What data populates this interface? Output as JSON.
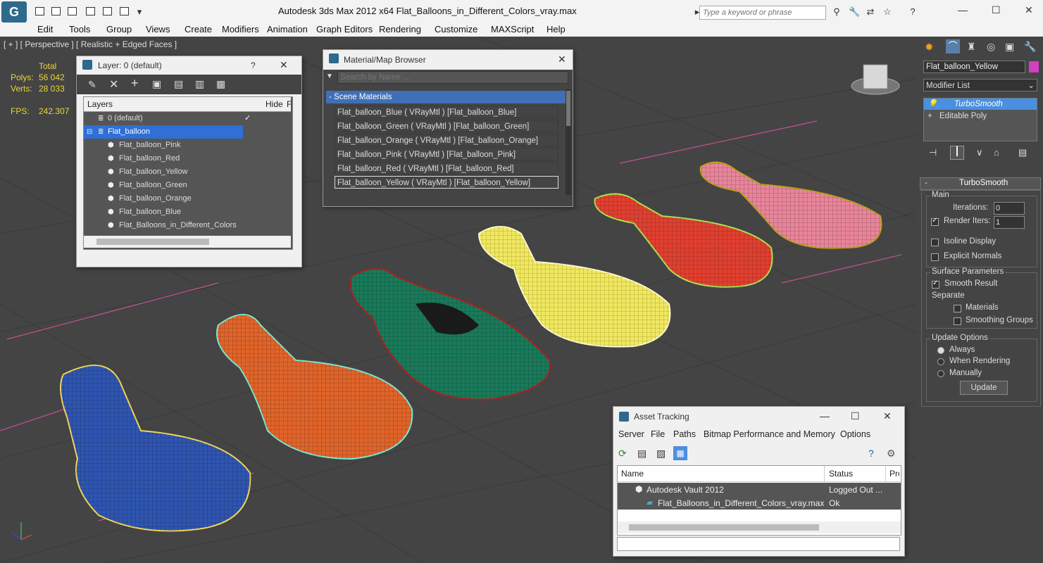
{
  "titlebar": {
    "logo_text": "G",
    "title": "Autodesk 3ds Max  2012 x64      Flat_Balloons_in_Different_Colors_vray.max",
    "search_placeholder": "Type a keyword or phrase",
    "quick_access_icons": [
      "new-icon",
      "open-icon",
      "save-icon",
      "undo-icon",
      "redo-icon",
      "settings-icon"
    ],
    "tool_icons": [
      "binoculars-icon",
      "tools-icon",
      "exchange-icon",
      "star-icon",
      "help-icon"
    ],
    "window_controls": [
      "—",
      "☐",
      "✕"
    ]
  },
  "menubar": {
    "items": [
      "Edit",
      "Tools",
      "Group",
      "Views",
      "Create",
      "Modifiers",
      "Animation",
      "Graph Editors",
      "Rendering",
      "Customize",
      "MAXScript",
      "Help"
    ]
  },
  "viewport": {
    "label": "[ + ] [ Perspective ] [ Realistic + Edged Faces ]",
    "stats": {
      "total_label": "Total",
      "polys_label": "Polys:",
      "polys_value": "56 042",
      "verts_label": "Verts:",
      "verts_value": "28 033",
      "fps_label": "FPS:",
      "fps_value": "242.307"
    },
    "balloon_colors": {
      "blue": "#2f55b0",
      "orange": "#e0642a",
      "green": "#1a7a5a",
      "yellow": "#f0e860",
      "red": "#e04030",
      "pink": "#e8859a"
    }
  },
  "layer_window": {
    "title": "Layer: 0 (default)",
    "help": "?",
    "close": "✕",
    "columns": {
      "layers": "Layers",
      "hide": "Hide",
      "freeze": "F"
    },
    "rows": [
      {
        "name": "0 (default)",
        "indent": 1
      },
      {
        "name": "Flat_balloon",
        "indent": 0
      },
      {
        "name": "Flat_balloon_Pink",
        "indent": 2
      },
      {
        "name": "Flat_balloon_Red",
        "indent": 2
      },
      {
        "name": "Flat_balloon_Yellow",
        "indent": 2
      },
      {
        "name": "Flat_balloon_Green",
        "indent": 2
      },
      {
        "name": "Flat_balloon_Orange",
        "indent": 2
      },
      {
        "name": "Flat_balloon_Blue",
        "indent": 2
      },
      {
        "name": "Flat_Balloons_in_Different_Colors",
        "indent": 2
      }
    ],
    "toolbar_icons": [
      "new-layer-icon",
      "delete-layer-icon",
      "add-selection-icon",
      "select-highlight-icon",
      "highlight-selected-icon",
      "hide-all-icon",
      "freeze-all-icon"
    ]
  },
  "material_browser": {
    "title": "Material/Map Browser",
    "close": "✕",
    "search_placeholder": "Search by Name ...",
    "group_label": "- Scene Materials",
    "materials": [
      "Flat_balloon_Blue  ( VRayMtl )  [Flat_balloon_Blue]",
      "Flat_balloon_Green  ( VRayMtl )  [Flat_balloon_Green]",
      "Flat_balloon_Orange  ( VRayMtl )  [Flat_balloon_Orange]",
      "Flat_balloon_Pink  ( VRayMtl )  [Flat_balloon_Pink]",
      "Flat_balloon_Red  ( VRayMtl )  [Flat_balloon_Red]",
      "Flat_balloon_Yellow  ( VRayMtl )  [Flat_balloon_Yellow]"
    ]
  },
  "command_panel": {
    "object_name": "Flat_balloon_Yellow",
    "object_color": "#d040c0",
    "modifier_list": "Modifier List",
    "stack": [
      "TurboSmooth",
      "Editable Poly"
    ],
    "rollout_title": "TurboSmooth",
    "main_label": "Main",
    "iterations_label": "Iterations:",
    "iterations_value": "0",
    "render_iters_label": "Render Iters:",
    "render_iters_value": "1",
    "isoline_label": "Isoline Display",
    "explicit_normals_label": "Explicit Normals",
    "surface_params_label": "Surface Parameters",
    "smooth_result_label": "Smooth Result",
    "separate_label": "Separate",
    "materials_label": "Materials",
    "smoothing_groups_label": "Smoothing Groups",
    "update_options_label": "Update Options",
    "always_label": "Always",
    "when_rendering_label": "When Rendering",
    "manually_label": "Manually",
    "update_button": "Update",
    "rollout_toggle": "-"
  },
  "asset_tracking": {
    "title": "Asset Tracking",
    "menu": [
      "Server",
      "File",
      "Paths",
      "Bitmap Performance and Memory",
      "Options"
    ],
    "columns": {
      "name": "Name",
      "status": "Status",
      "pro": "Pro"
    },
    "rows": [
      {
        "name": "Autodesk Vault 2012",
        "status": "Logged Out ..."
      },
      {
        "name": "Flat_Balloons_in_Different_Colors_vray.max",
        "status": "Ok"
      }
    ],
    "window_controls": [
      "—",
      "☐",
      "✕"
    ]
  }
}
